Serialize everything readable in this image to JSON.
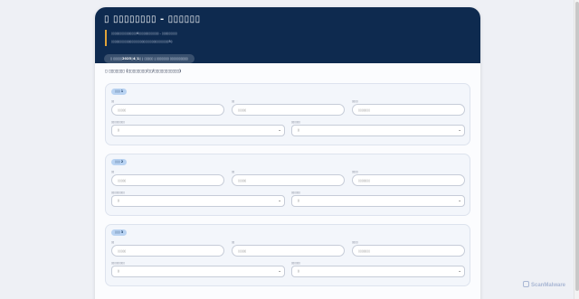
{
  "header": {
    "title": "▯ ▯▯▯▯▯▯▯▯ - ▯▯▯▯▯▯",
    "notice_lines": [
      "▯▯▯▯▯▯▯▯▯▯▯▯▯▯▯6▯▯▯▯▯▯▯▯▯▯▯▯ - ▯▯▯▯▯▯▯▯▯",
      "▯▯▯▯▯▯▯▯▯▯▯▯▯▯▯▯▯▯▯▯▯▯▯▯▯▯▯▯▯▯▯▯▯▯5▯"
    ],
    "deadline_prefix": "▯ ▯▯▯▯▯",
    "deadline_date": "2025▯4▯1▯",
    "deadline_suffix": "| ▯▯▯▯▯ | ▯▯▯▯▯▯▯ ▯▯▯▯▯▯▯▯▯▯"
  },
  "section": {
    "title": "▯ ▯▯▯▯▯▯▯ (▯▯▯▯▯▯▯▯/▯▯/▯▯▯▯▯▯▯▯▯▯▯)"
  },
  "members": [
    {
      "badge": "▯▯▯ 1",
      "field1_label": "▯▯",
      "field1_placeholder": "▯▯▯▯▯",
      "field2_label": "▯▯",
      "field2_placeholder": "▯▯▯▯▯",
      "field3_label": "▯▯▯▯",
      "field3_placeholder": "▯▯▯▯▯▯▯",
      "select1_label": "▯▯▯▯▯▯▯▯▯",
      "select1_value": "▯",
      "select2_label": "▯▯▯▯▯▯",
      "select2_value": "▯"
    },
    {
      "badge": "▯▯▯ 2",
      "field1_label": "▯▯",
      "field1_placeholder": "▯▯▯▯▯",
      "field2_label": "▯▯",
      "field2_placeholder": "▯▯▯▯▯",
      "field3_label": "▯▯▯▯",
      "field3_placeholder": "▯▯▯▯▯▯▯",
      "select1_label": "▯▯▯▯▯▯▯▯▯",
      "select1_value": "▯",
      "select2_label": "▯▯▯▯▯▯",
      "select2_value": "▯"
    },
    {
      "badge": "▯▯▯ 3",
      "field1_label": "▯▯",
      "field1_placeholder": "▯▯▯▯▯",
      "field2_label": "▯▯",
      "field2_placeholder": "▯▯▯▯▯",
      "field3_label": "▯▯▯▯",
      "field3_placeholder": "▯▯▯▯▯▯▯",
      "select1_label": "▯▯▯▯▯▯▯▯▯",
      "select1_value": "▯",
      "select2_label": "▯▯▯▯▯▯",
      "select2_value": "▯"
    }
  ],
  "watermark": "ScanMalware",
  "colors": {
    "header_bg": "#0e2a4f",
    "accent_bar": "#e0a33a",
    "badge_bg": "#b9d3f2",
    "page_bg": "#eef0f5"
  }
}
